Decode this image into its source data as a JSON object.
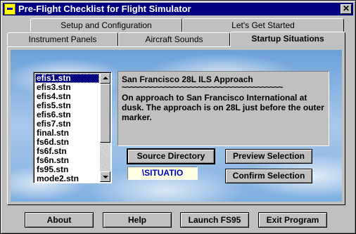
{
  "window": {
    "title": "Pre-Flight Checklist for Flight Simulator",
    "close_glyph": "✕"
  },
  "tabs": {
    "back_row": [
      "Setup and Configuration",
      "Let's Get Started"
    ],
    "front_row": [
      "Instrument Panels",
      "Aircraft Sounds",
      "Startup Situations"
    ],
    "active": "Startup Situations"
  },
  "file_list": {
    "items": [
      "efis1.stn",
      "efis3.stn",
      "efis4.stn",
      "efis5.stn",
      "efis6.stn",
      "efis7.stn",
      "final.stn",
      "fs6d.stn",
      "fs6f.stn",
      "fs6n.stn",
      "fs95.stn",
      "mode2.stn"
    ],
    "selected": "efis1.stn"
  },
  "description": {
    "title": "San Francisco 28L ILS Approach",
    "separator": "~~~~~~~~~~~~~~~~~~~~~~~~~~~~~~~~~~~~~~",
    "body": "On approach to San Francisco International at dusk.  The approach is on 28L just before the outer marker."
  },
  "situation_buttons": {
    "source_directory": "Source Directory",
    "preview": "Preview Selection",
    "confirm": "Confirm Selection"
  },
  "directory_value": "\\SITUATIO",
  "bottom_buttons": {
    "about": "About",
    "help": "Help",
    "launch": "Launch FS95",
    "exit": "Exit Program"
  }
}
